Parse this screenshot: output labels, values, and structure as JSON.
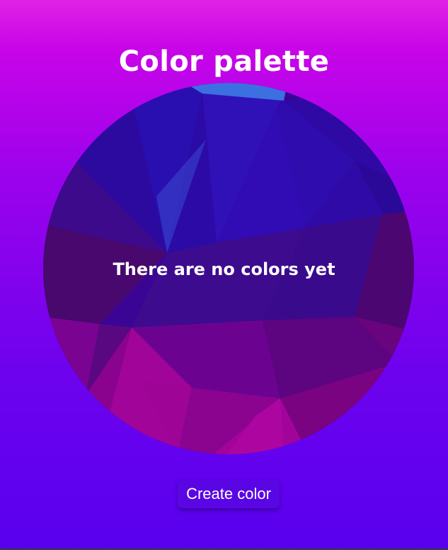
{
  "header": {
    "title": "Color palette"
  },
  "main": {
    "empty_message": "There are no colors yet",
    "create_button_label": "Create color"
  },
  "colors": {
    "background_top": "#e022e6",
    "background_bottom": "#5800ee",
    "button": "#5a06e4",
    "text": "#ffffff"
  }
}
